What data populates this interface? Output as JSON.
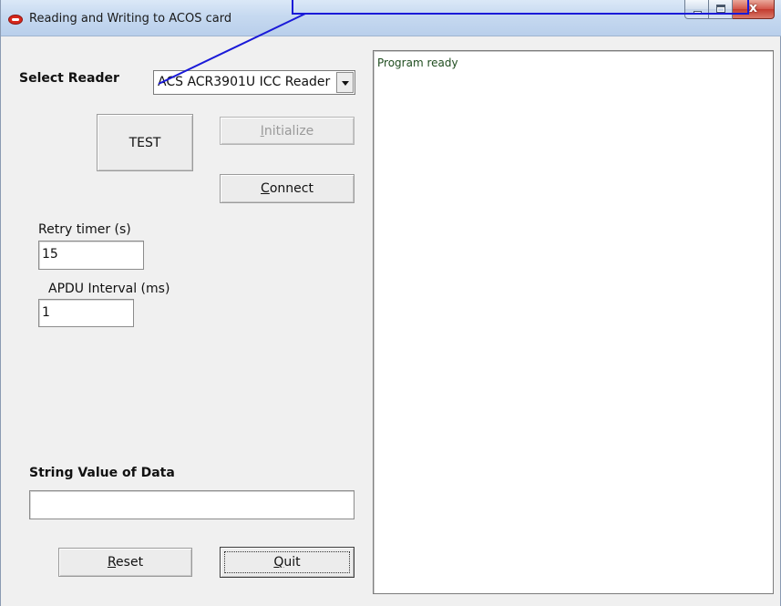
{
  "window": {
    "title": "Reading and Writing to ACOS card",
    "close_glyph": "x"
  },
  "reader": {
    "label": "Select Reader",
    "selected": "ACS ACR3901U ICC Reader"
  },
  "buttons": {
    "test": "TEST",
    "initialize_accel": "I",
    "initialize_rest": "nitialize",
    "connect_accel": "C",
    "connect_rest": "onnect",
    "reset_accel": "R",
    "reset_rest": "eset",
    "quit_accel": "Q",
    "quit_rest": "uit"
  },
  "settings": {
    "retry_label": "Retry timer (s)",
    "retry_value": "15",
    "apdu_label": "APDU Interval (ms)",
    "apdu_value": "1"
  },
  "data": {
    "label": "String Value of Data",
    "value": ""
  },
  "log": {
    "lines": [
      "Program ready"
    ]
  },
  "colors": {
    "callout": "#1a1ad8",
    "log_text": "#1f4d1f"
  }
}
